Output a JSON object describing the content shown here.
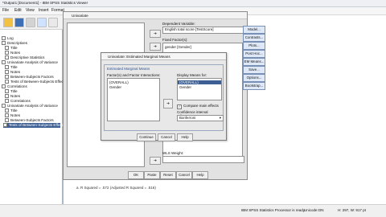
{
  "app": {
    "window_title": "*Output1 [Document1] - IBM SPSS Statistics Viewer",
    "menu": [
      "File",
      "Edit",
      "View",
      "Insert",
      "Format"
    ]
  },
  "outline": {
    "items": [
      {
        "label": "Log",
        "indent": 0
      },
      {
        "label": "Descriptives",
        "indent": 0
      },
      {
        "label": "Title",
        "indent": 1
      },
      {
        "label": "Notes",
        "indent": 1
      },
      {
        "label": "Descriptive Statistics",
        "indent": 1
      },
      {
        "label": "Univariate Analysis of Variance",
        "indent": 0
      },
      {
        "label": "Title",
        "indent": 1
      },
      {
        "label": "Notes",
        "indent": 1
      },
      {
        "label": "Between-Subjects Factors",
        "indent": 1
      },
      {
        "label": "Tests of Between-Subjects Effects",
        "indent": 1
      },
      {
        "label": "Correlations",
        "indent": 0
      },
      {
        "label": "Title",
        "indent": 1
      },
      {
        "label": "Notes",
        "indent": 1
      },
      {
        "label": "Correlations",
        "indent": 1
      },
      {
        "label": "Univariate Analysis of Variance",
        "indent": 0
      },
      {
        "label": "Title",
        "indent": 1
      },
      {
        "label": "Notes",
        "indent": 1
      },
      {
        "label": "Between-Subjects Factors",
        "indent": 1
      },
      {
        "label": "Tests of Between-Subjects Effects",
        "indent": 1,
        "selected": true
      }
    ]
  },
  "univariate": {
    "title": "Univariate",
    "dependent_label": "Dependent Variable:",
    "dependent_value": "English total score [TestScore]",
    "fixed_label": "Fixed Factor(s):",
    "fixed_value": "gender [Gender]",
    "wls_label": "WLS Weight:",
    "side_buttons": [
      "Model...",
      "Contrasts...",
      "Plots...",
      "Post Hoc...",
      "EM Means...",
      "Save...",
      "Options...",
      "Bootstrap..."
    ],
    "bottom_buttons": [
      "OK",
      "Paste",
      "Reset",
      "Cancel",
      "Help"
    ]
  },
  "emm": {
    "title": "Univariate: Estimated Marginal Means",
    "group_title": "Estimated Marginal Means",
    "factors_label": "Factor(s) and Factor Interactions:",
    "factors": [
      "(OVERALL)",
      "Gender"
    ],
    "display_label": "Display Means for:",
    "display": [
      "(OVERALL)",
      "Gender"
    ],
    "compare_label": "Compare main effects",
    "compare_checked": true,
    "ci_label": "Confidence interval adjustment:",
    "ci_value": "Bonferroni",
    "buttons": [
      "Continue",
      "Cancel",
      "Help"
    ]
  },
  "output_text": "a. R Squared = .572 (Adjusted R Squared = .516)",
  "status": {
    "processor": "IBM SPSS Statistics Processor is ready",
    "unicode": "Unicode:ON",
    "coords": "H: 297, W: 917 pt"
  }
}
